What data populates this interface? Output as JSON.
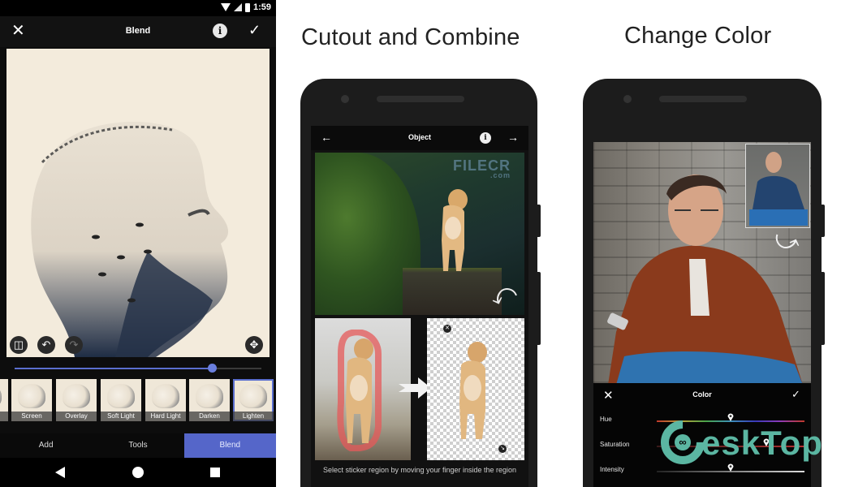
{
  "panel_blend": {
    "status_bar": {
      "time": "1:59"
    },
    "app_bar": {
      "close_icon": "close-icon",
      "title": "Blend",
      "info_icon": "info-icon",
      "confirm_icon": "check-icon"
    },
    "canvas_tools": {
      "compare": "split-view-icon",
      "undo": "undo-icon",
      "redo": "redo-icon",
      "move": "move-icon"
    },
    "opacity_slider": {
      "value_percent": 80
    },
    "blend_modes": [
      {
        "label": ""
      },
      {
        "label": "Screen"
      },
      {
        "label": "Overlay"
      },
      {
        "label": "Soft Light"
      },
      {
        "label": "Hard Light"
      },
      {
        "label": "Darken"
      },
      {
        "label": "Lighten",
        "selected": true
      }
    ],
    "bottom_tabs": [
      {
        "label": "Add"
      },
      {
        "label": "Tools"
      },
      {
        "label": "Blend",
        "active": true
      }
    ],
    "nav_bar": {
      "back": "back-icon",
      "home": "home-icon",
      "recents": "recents-icon"
    },
    "accent_color": "#5566c9"
  },
  "panel_cutout": {
    "heading": "Cutout and Combine",
    "app_bar": {
      "back_icon": "arrow-left-icon",
      "title": "Object",
      "info_icon": "info-icon",
      "forward_icon": "arrow-right-icon"
    },
    "watermark": {
      "brand": "FILECR",
      "suffix": ".com"
    },
    "caption": "Select sticker region by moving your finger inside the region"
  },
  "panel_color": {
    "heading": "Change Color",
    "color_bar": {
      "close_icon": "close-icon",
      "title": "Color",
      "confirm_icon": "check-icon",
      "sliders": [
        {
          "label": "Hue",
          "value_percent": 50
        },
        {
          "label": "Saturation",
          "value_percent": 74
        },
        {
          "label": "Intensity",
          "value_percent": 50
        }
      ]
    },
    "watermark": {
      "brand_prefix": "∞",
      "brand": "eskTop"
    }
  },
  "glyphs": {
    "close": "✕",
    "check": "✓",
    "info": "i",
    "arrow_left": "←",
    "arrow_right": "→",
    "undo": "↶",
    "redo": "↷",
    "move": "✥",
    "split": "◫",
    "curve_arrow": "⤺"
  }
}
